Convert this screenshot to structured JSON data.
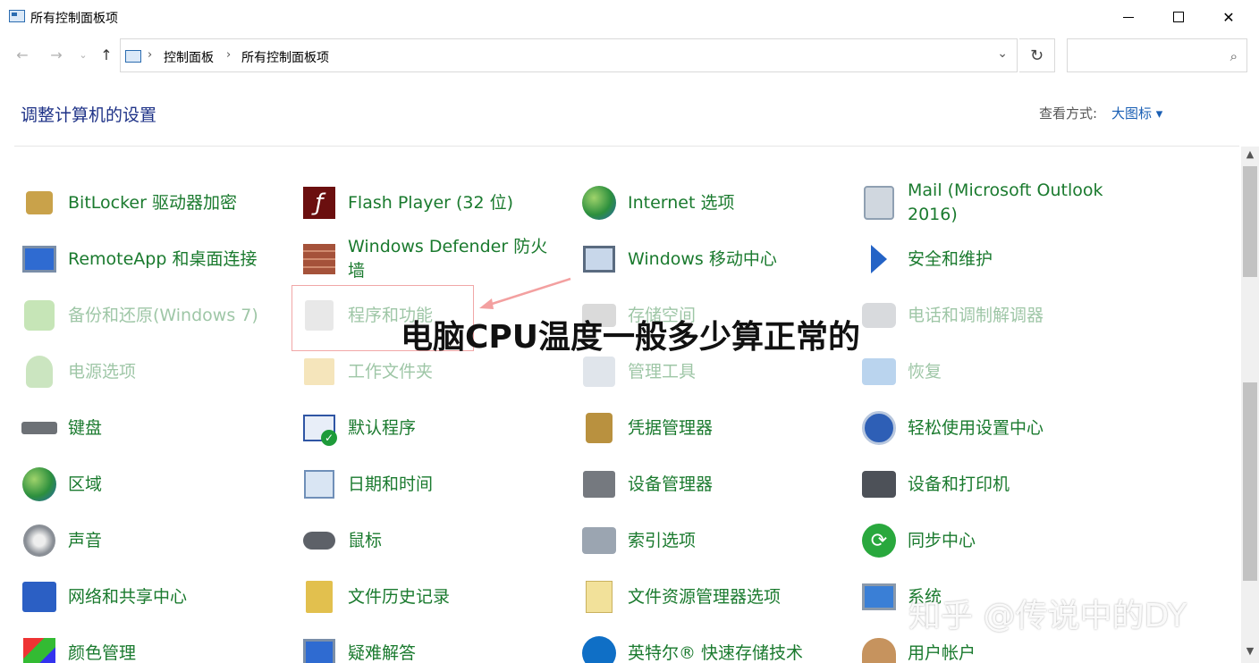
{
  "window": {
    "title": "所有控制面板项",
    "min_glyph": "",
    "close_glyph": "✕"
  },
  "nav": {
    "back": "←",
    "forward": "→",
    "recent": "⌄",
    "up": "↑",
    "breadcrumb": [
      "控制面板",
      "所有控制面板项"
    ],
    "separator": "›",
    "dropdown": "⌄",
    "refresh": "↻",
    "search_placeholder": "",
    "search_icon": "⌕"
  },
  "header": {
    "title": "调整计算机的设置",
    "view_by_label": "查看方式:",
    "view_by_value": "大图标 ▾"
  },
  "items": [
    {
      "label": "BitLocker 驱动器加密",
      "icon": "bitlocker-icon",
      "faded": false
    },
    {
      "label": "Flash Player (32 位)",
      "icon": "flash-player-icon",
      "faded": false
    },
    {
      "label": "Internet 选项",
      "icon": "internet-options-icon",
      "faded": false
    },
    {
      "label": "Mail (Microsoft Outlook 2016)",
      "icon": "mail-icon",
      "faded": false
    },
    {
      "label": "RemoteApp 和桌面连接",
      "icon": "remoteapp-icon",
      "faded": false
    },
    {
      "label": "Windows Defender 防火墙",
      "icon": "firewall-icon",
      "faded": false
    },
    {
      "label": "Windows 移动中心",
      "icon": "mobility-center-icon",
      "faded": false
    },
    {
      "label": "安全和维护",
      "icon": "security-flag-icon",
      "faded": false
    },
    {
      "label": "备份和还原(Windows 7)",
      "icon": "backup-restore-icon",
      "faded": true
    },
    {
      "label": "程序和功能",
      "icon": "programs-features-icon",
      "faded": true
    },
    {
      "label": "存储空间",
      "icon": "storage-spaces-icon",
      "faded": true
    },
    {
      "label": "电话和调制解调器",
      "icon": "phone-modem-icon",
      "faded": true
    },
    {
      "label": "电源选项",
      "icon": "power-options-icon",
      "faded": true
    },
    {
      "label": "工作文件夹",
      "icon": "work-folders-icon",
      "faded": true
    },
    {
      "label": "管理工具",
      "icon": "admin-tools-icon",
      "faded": true
    },
    {
      "label": "恢复",
      "icon": "recovery-icon",
      "faded": true
    },
    {
      "label": "键盘",
      "icon": "keyboard-icon",
      "faded": false
    },
    {
      "label": "默认程序",
      "icon": "default-programs-icon",
      "faded": false
    },
    {
      "label": "凭据管理器",
      "icon": "credential-manager-icon",
      "faded": false
    },
    {
      "label": "轻松使用设置中心",
      "icon": "ease-of-access-icon",
      "faded": false
    },
    {
      "label": "区域",
      "icon": "region-icon",
      "faded": false
    },
    {
      "label": "日期和时间",
      "icon": "date-time-icon",
      "faded": false
    },
    {
      "label": "设备管理器",
      "icon": "device-manager-icon",
      "faded": false
    },
    {
      "label": "设备和打印机",
      "icon": "devices-printers-icon",
      "faded": false
    },
    {
      "label": "声音",
      "icon": "sound-icon",
      "faded": false
    },
    {
      "label": "鼠标",
      "icon": "mouse-icon",
      "faded": false
    },
    {
      "label": "索引选项",
      "icon": "indexing-options-icon",
      "faded": false
    },
    {
      "label": "同步中心",
      "icon": "sync-center-icon",
      "faded": false
    },
    {
      "label": "网络和共享中心",
      "icon": "network-sharing-icon",
      "faded": false
    },
    {
      "label": "文件历史记录",
      "icon": "file-history-icon",
      "faded": false
    },
    {
      "label": "文件资源管理器选项",
      "icon": "explorer-options-icon",
      "faded": false
    },
    {
      "label": "系统",
      "icon": "system-icon",
      "faded": false
    },
    {
      "label": "颜色管理",
      "icon": "color-management-icon",
      "faded": false
    },
    {
      "label": "疑难解答",
      "icon": "troubleshooting-icon",
      "faded": false
    },
    {
      "label": "英特尔® 快速存储技术",
      "icon": "intel-rst-icon",
      "faded": false
    },
    {
      "label": "用户帐户",
      "icon": "user-accounts-icon",
      "faded": false
    }
  ],
  "overlay": {
    "title": "电脑CPU温度一般多少算正常的",
    "watermark": "知乎 @传说中的DY"
  },
  "scrollbar": {
    "up": "▲",
    "down": "▼"
  }
}
